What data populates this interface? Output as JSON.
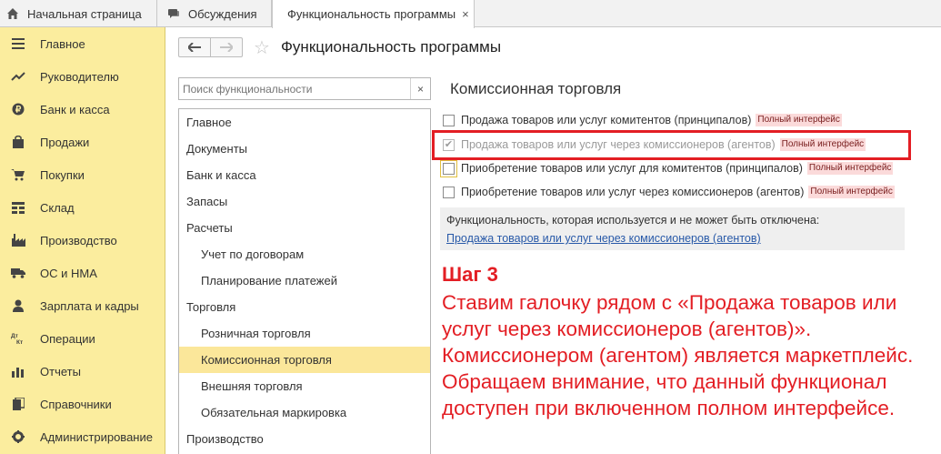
{
  "tabs": {
    "home": "Начальная страница",
    "discussions": "Обсуждения",
    "functionality": "Функциональность программы",
    "close_glyph": "×"
  },
  "sidebar": {
    "items": [
      {
        "label": "Главное",
        "icon": "menu-icon"
      },
      {
        "label": "Руководителю",
        "icon": "trend-icon"
      },
      {
        "label": "Банк и касса",
        "icon": "coin-icon"
      },
      {
        "label": "Продажи",
        "icon": "bag-icon"
      },
      {
        "label": "Покупки",
        "icon": "cart-icon"
      },
      {
        "label": "Склад",
        "icon": "grid-icon"
      },
      {
        "label": "Производство",
        "icon": "factory-icon"
      },
      {
        "label": "ОС и НМА",
        "icon": "truck-icon"
      },
      {
        "label": "Зарплата и кадры",
        "icon": "person-icon"
      },
      {
        "label": "Операции",
        "icon": "dt-kt-icon"
      },
      {
        "label": "Отчеты",
        "icon": "bar-chart-icon"
      },
      {
        "label": "Справочники",
        "icon": "book-icon"
      },
      {
        "label": "Администрирование",
        "icon": "gear-icon"
      }
    ]
  },
  "header": {
    "title": "Функциональность программы",
    "back": "🡐",
    "forward": "🡒",
    "star": "☆"
  },
  "search": {
    "placeholder": "Поиск функциональности",
    "clear": "×"
  },
  "tree": {
    "items": [
      {
        "label": "Главное",
        "level": 1
      },
      {
        "label": "Документы",
        "level": 1
      },
      {
        "label": "Банк и касса",
        "level": 1
      },
      {
        "label": "Запасы",
        "level": 1
      },
      {
        "label": "Расчеты",
        "level": 1
      },
      {
        "label": "Учет по договорам",
        "level": 2
      },
      {
        "label": "Планирование платежей",
        "level": 2
      },
      {
        "label": "Торговля",
        "level": 1
      },
      {
        "label": "Розничная торговля",
        "level": 2
      },
      {
        "label": "Комиссионная торговля",
        "level": 2,
        "selected": true
      },
      {
        "label": "Внешняя торговля",
        "level": 2
      },
      {
        "label": "Обязательная маркировка",
        "level": 2
      },
      {
        "label": "Производство",
        "level": 1
      }
    ]
  },
  "content": {
    "section_title": "Комиссионная торговля",
    "options": [
      {
        "label": "Продажа товаров или услуг комитентов (принципалов)",
        "badge": "Полный интерфейс",
        "checked": false,
        "disabled": false
      },
      {
        "label": "Продажа товаров или услуг через комиссионеров (агентов)",
        "badge": "Полный интерфейс",
        "checked": true,
        "disabled": true
      },
      {
        "label": "Приобретение товаров или услуг для комитентов (принципалов)",
        "badge": "Полный интерфейс",
        "checked": false,
        "disabled": false
      },
      {
        "label": "Приобретение товаров или услуг через комиссионеров (агентов)",
        "badge": "Полный интерфейс",
        "checked": false,
        "disabled": false
      }
    ],
    "info_text": "Функциональность, которая используется и не может быть отключена:",
    "info_link": "Продажа товаров или услуг через комиссионеров (агентов)"
  },
  "annotation": {
    "step_title": "Шаг 3",
    "step_text": "Ставим галочку рядом с «Продажа товаров или услуг через комиссионеров (агентов)». Комиссионером (агентом) является маркетплейс. Обращаем внимание, что данный функционал доступен при включенном полном интерфейсе.",
    "highlight_color": "#e31e24"
  },
  "colors": {
    "sidebar_bg": "#fbed9e",
    "selected_row": "#fbe79a",
    "badge_bg": "#fbdada",
    "link": "#2859a8"
  }
}
